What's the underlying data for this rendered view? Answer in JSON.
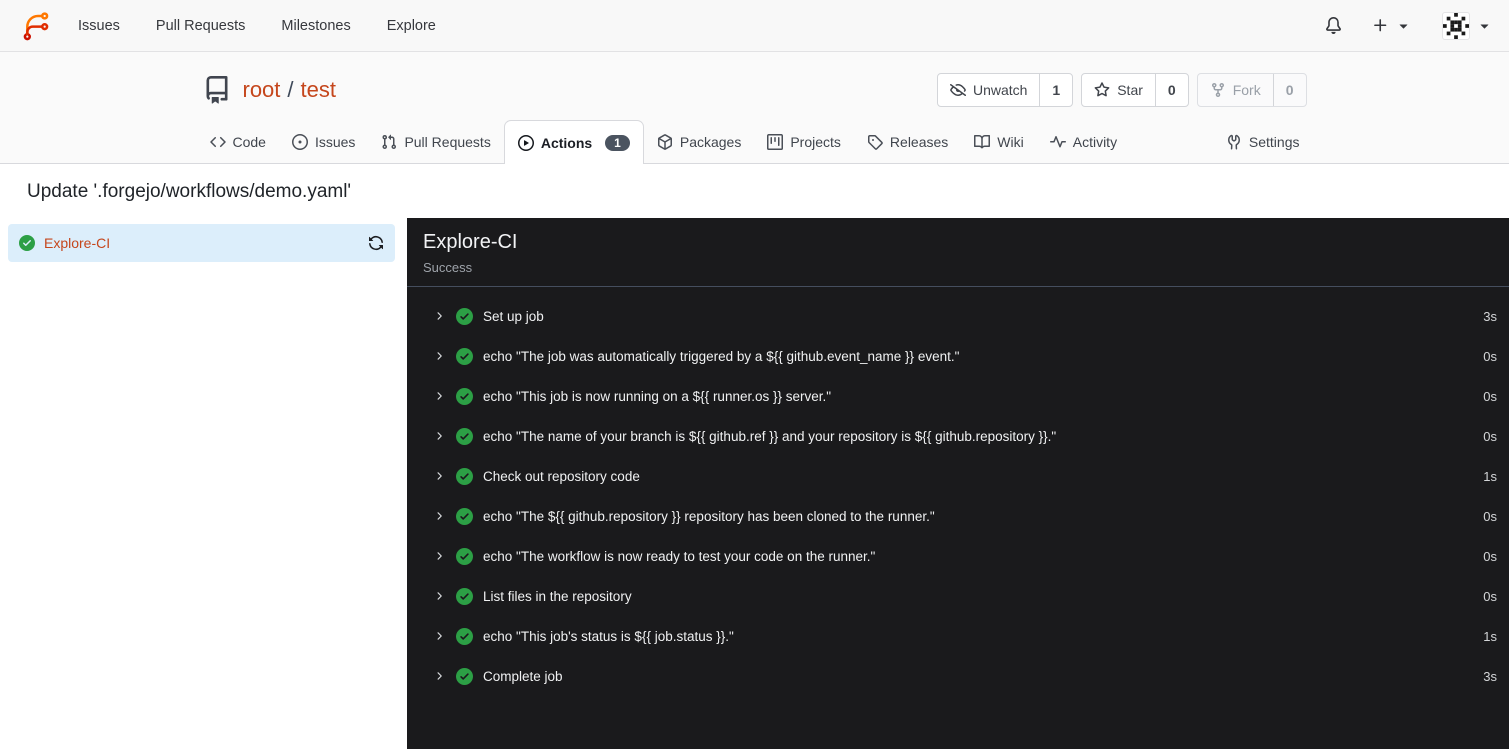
{
  "navbar": {
    "items": [
      {
        "label": "Issues"
      },
      {
        "label": "Pull Requests"
      },
      {
        "label": "Milestones"
      },
      {
        "label": "Explore"
      }
    ]
  },
  "repo_header": {
    "owner": "root",
    "separator": "/",
    "name": "test",
    "actions": [
      {
        "label": "Unwatch",
        "count": "1",
        "icon": "eye-slash-icon",
        "disabled": false
      },
      {
        "label": "Star",
        "count": "0",
        "icon": "star-icon",
        "disabled": false
      },
      {
        "label": "Fork",
        "count": "0",
        "icon": "fork-icon",
        "disabled": true
      }
    ]
  },
  "tabs": [
    {
      "label": "Code",
      "icon": "code-icon"
    },
    {
      "label": "Issues",
      "icon": "issue-icon"
    },
    {
      "label": "Pull Requests",
      "icon": "pull-request-icon"
    },
    {
      "label": "Actions",
      "icon": "play-circle-icon",
      "badge": "1",
      "active": true
    },
    {
      "label": "Packages",
      "icon": "package-icon"
    },
    {
      "label": "Projects",
      "icon": "project-icon"
    },
    {
      "label": "Releases",
      "icon": "tag-icon"
    },
    {
      "label": "Wiki",
      "icon": "book-icon"
    },
    {
      "label": "Activity",
      "icon": "pulse-icon"
    },
    {
      "label": "Settings",
      "icon": "tools-icon"
    }
  ],
  "page": {
    "title": "Update '.forgejo/workflows/demo.yaml'"
  },
  "sidebar": {
    "job": {
      "name": "Explore-CI",
      "status": "success"
    }
  },
  "run_panel": {
    "title": "Explore-CI",
    "status": "Success",
    "steps": [
      {
        "name": "Set up job",
        "duration": "3s"
      },
      {
        "name": "echo \"The job was automatically triggered by a ${{ github.event_name }} event.\"",
        "duration": "0s"
      },
      {
        "name": "echo \"This job is now running on a ${{ runner.os }} server.\"",
        "duration": "0s"
      },
      {
        "name": "echo \"The name of your branch is ${{ github.ref }} and your repository is ${{ github.repository }}.\"",
        "duration": "0s"
      },
      {
        "name": "Check out repository code",
        "duration": "1s"
      },
      {
        "name": "echo \"The ${{ github.repository }} repository has been cloned to the runner.\"",
        "duration": "0s"
      },
      {
        "name": "echo \"The workflow is now ready to test your code on the runner.\"",
        "duration": "0s"
      },
      {
        "name": "List files in the repository",
        "duration": "0s"
      },
      {
        "name": "echo \"This job's status is ${{ job.status }}.\"",
        "duration": "1s"
      },
      {
        "name": "Complete job",
        "duration": "3s"
      }
    ]
  },
  "colors": {
    "accent_link": "#c5461c",
    "success_green": "#2c9f45",
    "badge_bg": "#4b5460",
    "panel_bg": "#1a1a1c",
    "panel_border": "#454e5e",
    "sidebar_selected_bg": "#dceefb"
  }
}
